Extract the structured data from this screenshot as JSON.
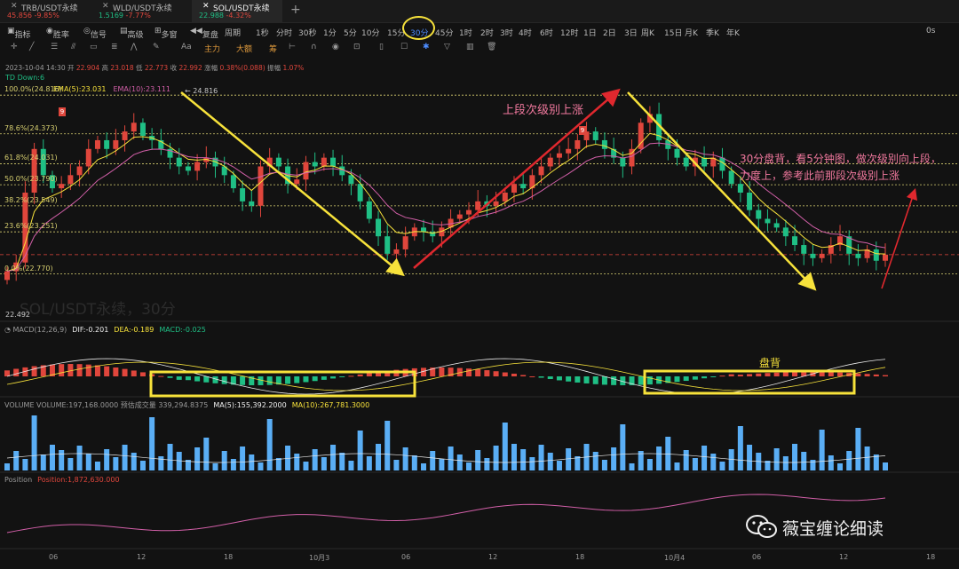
{
  "tabs": [
    {
      "symbol": "TRB/USDT永续",
      "price": "45.856",
      "change": "-9.85%"
    },
    {
      "symbol": "WLD/USDT永续",
      "price": "1.5169",
      "change": "-7.77%"
    },
    {
      "symbol": "SOL/USDT永续",
      "price": "22.988",
      "change": "-4.32%"
    }
  ],
  "add_tab": "+",
  "toolbar": {
    "indicator": "指标",
    "winrate": "胜率",
    "signal": "信号",
    "advanced": "高级",
    "multiwin": "多窗",
    "replay": "复盘",
    "period_label": "周期",
    "periods": [
      "1秒",
      "分时",
      "30秒",
      "1分",
      "5分",
      "10分",
      "15分",
      "30分",
      "45分",
      "1时",
      "2时",
      "3时",
      "4时",
      "6时",
      "12时",
      "1日",
      "2日",
      "3日",
      "周K",
      "15日",
      "月K",
      "季K",
      "年K"
    ],
    "active_period": "30分",
    "timer": "0s"
  },
  "toolbar2": {
    "main": "主力",
    "large": "大额",
    "chips": "筹",
    "text_tool": "Aa"
  },
  "ohlc_line": {
    "date": "2023-10-04 14:30",
    "open": "22.904",
    "high": "23.018",
    "low": "22.773",
    "close": "22.992",
    "change": "0.38%(0.088)",
    "amplitude": "1.07%",
    "labels": {
      "open": "开",
      "high": "高",
      "low": "低",
      "close": "收",
      "change": "涨幅",
      "amplitude": "振幅"
    }
  },
  "td_label": "TD  Down:6",
  "ema": {
    "ema5": "EMA(5):23.031",
    "ema10": "EMA(10):23.111"
  },
  "fib_levels": [
    {
      "label": "100.0%(24.816)",
      "price": 24.816
    },
    {
      "label": "78.6%(24.373)",
      "price": 24.373
    },
    {
      "label": "61.8%(24.031)",
      "price": 24.031
    },
    {
      "label": "50.0%(23.790)",
      "price": 23.79
    },
    {
      "label": "38.2%(23.549)",
      "price": 23.549
    },
    {
      "label": "23.6%(23.251)",
      "price": 23.251
    },
    {
      "label": "0.0%(22.770)",
      "price": 22.77
    }
  ],
  "high_marker": "24.816",
  "low_marker": "22.492",
  "watermark": "SOL/USDT永续，30分",
  "td_badges": [
    "9",
    "9"
  ],
  "annotations": {
    "upper_rally": "上段次级别上涨",
    "note_line1": "30分盘背，看5分钟图，做次级别向上段，",
    "note_line2": "力度上，参考此前那段次级别上涨",
    "divergence": "盘背"
  },
  "macd": {
    "name": "MACD(12,26,9)",
    "dif": "DIF:-0.201",
    "dea": "DEA:-0.189",
    "macd": "MACD:-0.025"
  },
  "volume": {
    "name": "VOLUME",
    "vol": "VOLUME:197,168.0000",
    "estimate": "预估成交量 339,294.8375",
    "ma5": "MA(5):155,392.2000",
    "ma10": "MA(10):267,781.3000"
  },
  "position": {
    "name": "Position",
    "value": "Position:1,872,630.000"
  },
  "x_axis": [
    "06",
    "12",
    "18",
    "10月3",
    "06",
    "12",
    "18",
    "10月4",
    "06",
    "12",
    "18"
  ],
  "brand": "薇宝缠论细读",
  "colors": {
    "up": "#e0463c",
    "down": "#1fbf85",
    "fib": "#d8d070",
    "highlight": "#f7e23b",
    "arrow_down": "#f7e23b",
    "arrow_up": "#e0282e",
    "volume": "#5aaef5"
  },
  "chart_data": {
    "type": "candlestick",
    "symbol": "SOL/USDT永续",
    "interval": "30分",
    "ylim": [
      22.45,
      24.95
    ],
    "close": [
      22.8,
      22.9,
      23.7,
      24.2,
      23.9,
      23.75,
      23.8,
      23.9,
      24.0,
      24.2,
      24.3,
      24.2,
      24.3,
      24.4,
      24.5,
      24.35,
      24.3,
      24.2,
      24.1,
      24.0,
      23.95,
      24.05,
      24.1,
      24.0,
      23.9,
      23.75,
      23.6,
      23.55,
      24.0,
      24.1,
      24.0,
      23.8,
      23.85,
      24.05,
      24.0,
      24.1,
      24.0,
      23.9,
      23.8,
      23.6,
      23.4,
      23.2,
      23.0,
      23.05,
      23.2,
      23.3,
      23.25,
      23.2,
      23.3,
      23.4,
      23.45,
      23.5,
      23.6,
      23.55,
      23.6,
      23.7,
      23.8,
      23.75,
      23.9,
      24.0,
      24.1,
      24.15,
      24.2,
      24.3,
      24.4,
      24.3,
      24.2,
      24.1,
      24.0,
      24.2,
      24.5,
      24.6,
      24.3,
      24.2,
      24.1,
      24.0,
      24.1,
      24.0,
      24.1,
      23.95,
      23.8,
      23.7,
      23.5,
      23.4,
      23.35,
      23.3,
      23.2,
      23.1,
      23.0,
      22.95,
      23.0,
      23.1,
      23.2,
      23.0,
      22.95,
      23.05,
      22.92,
      22.99
    ]
  }
}
